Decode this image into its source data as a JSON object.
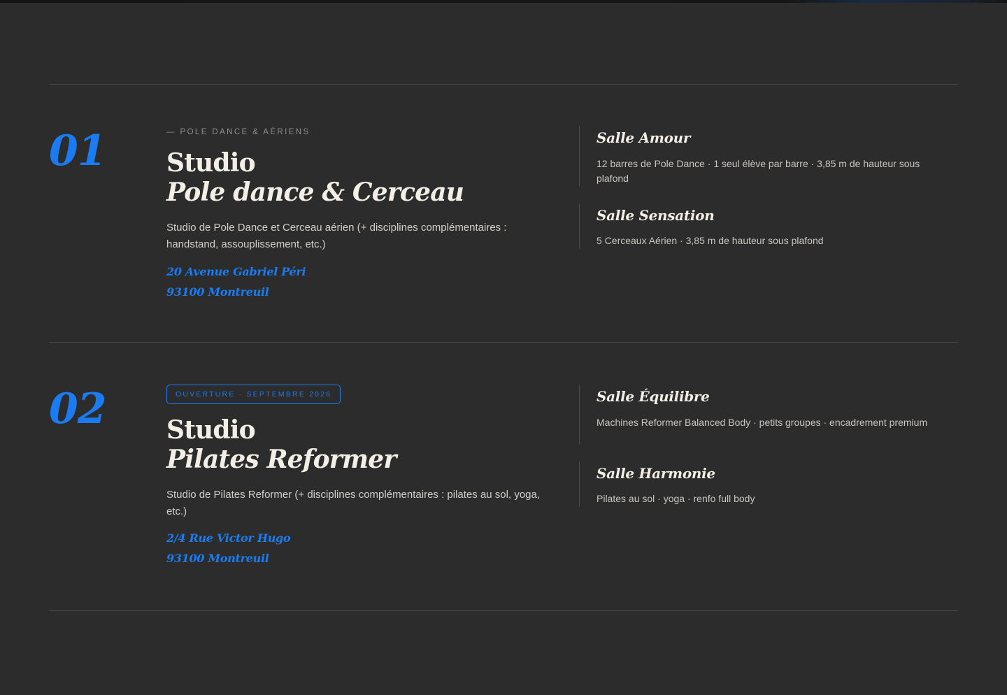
{
  "studios": [
    {
      "number": "01",
      "eyebrow": "— POLE DANCE & AÉRIENS",
      "badge": "",
      "title": "Studio",
      "subtitle": "Pole dance & Cerceau",
      "description": "Studio de Pole Dance et Cerceau aérien (+ disciplines complémentaires : handstand, assouplissement, etc.)",
      "address_line1": "20 Avenue Gabriel Péri",
      "address_line2": "93100 Montreuil",
      "rooms": [
        {
          "name": "Salle Amour",
          "description": "12 barres de Pole Dance · 1 seul élève par barre · 3,85 m de hauteur sous plafond"
        },
        {
          "name": "Salle Sensation",
          "description": "5 Cerceaux Aérien · 3,85 m de hauteur sous plafond"
        }
      ]
    },
    {
      "number": "02",
      "eyebrow": "",
      "badge": "OUVERTURE · SEPTEMBRE 2026",
      "title": "Studio",
      "subtitle": "Pilates Reformer",
      "description": "Studio de Pilates Reformer (+ disciplines complémentaires : pilates au sol, yoga, etc.)",
      "address_line1": "2/4 Rue Victor Hugo",
      "address_line2": "93100 Montreuil",
      "rooms": [
        {
          "name": "Salle Équilibre",
          "description": "Machines Reformer Balanced Body · petits groupes · encadrement premium"
        },
        {
          "name": "Salle Harmonie",
          "description": "Pilates au sol · yoga · renfo full body"
        }
      ]
    }
  ],
  "colors": {
    "background": "#2c2c2c",
    "accent": "#1b7cf2",
    "text": "#f3efe6",
    "muted": "#8e8e8e",
    "divider": "#4a4a4a"
  }
}
